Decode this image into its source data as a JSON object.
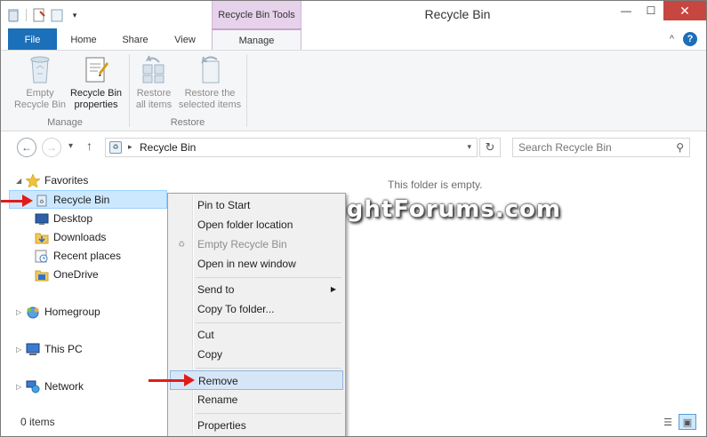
{
  "window": {
    "title": "Recycle Bin",
    "contextual_tab_group": "Recycle Bin Tools",
    "minimize_icon": "minimize-icon",
    "maximize_icon": "maximize-icon",
    "close_icon": "close-icon"
  },
  "ribbon_tabs": {
    "file": "File",
    "home": "Home",
    "share": "Share",
    "view": "View",
    "manage": "Manage"
  },
  "ribbon": {
    "empty_recycle_bin": {
      "line1": "Empty",
      "line2": "Recycle Bin",
      "icon": "empty-bin-icon"
    },
    "recycle_bin_properties": {
      "line1": "Recycle Bin",
      "line2": "properties",
      "icon": "properties-icon"
    },
    "restore_all_items": {
      "line1": "Restore",
      "line2": "all items",
      "icon": "restore-all-icon"
    },
    "restore_selected_items": {
      "line1": "Restore the",
      "line2": "selected items",
      "icon": "restore-selected-icon"
    },
    "group_manage": "Manage",
    "group_restore": "Restore"
  },
  "address": {
    "path": "Recycle Bin",
    "search_placeholder": "Search Recycle Bin"
  },
  "nav": {
    "favorites": "Favorites",
    "recycle_bin": "Recycle Bin",
    "desktop": "Desktop",
    "downloads": "Downloads",
    "recent_places": "Recent places",
    "onedrive": "OneDrive",
    "homegroup": "Homegroup",
    "this_pc": "This PC",
    "network": "Network"
  },
  "content": {
    "empty_message": "This folder is empty.",
    "watermark": "EightForums.com"
  },
  "context_menu": {
    "pin_to_start": "Pin to Start",
    "open_folder_location": "Open folder location",
    "empty_recycle_bin": "Empty Recycle Bin",
    "open_in_new_window": "Open in new window",
    "send_to": "Send to",
    "copy_to_folder": "Copy To folder...",
    "cut": "Cut",
    "copy": "Copy",
    "remove": "Remove",
    "rename": "Rename",
    "properties": "Properties"
  },
  "status": {
    "item_count": "0 items"
  },
  "colors": {
    "file_tab": "#1c6fb9",
    "context_tab": "#e6d2ea",
    "selection": "#cce8ff",
    "close_button": "#c7463f",
    "annotation_arrow": "#e21b1b"
  }
}
